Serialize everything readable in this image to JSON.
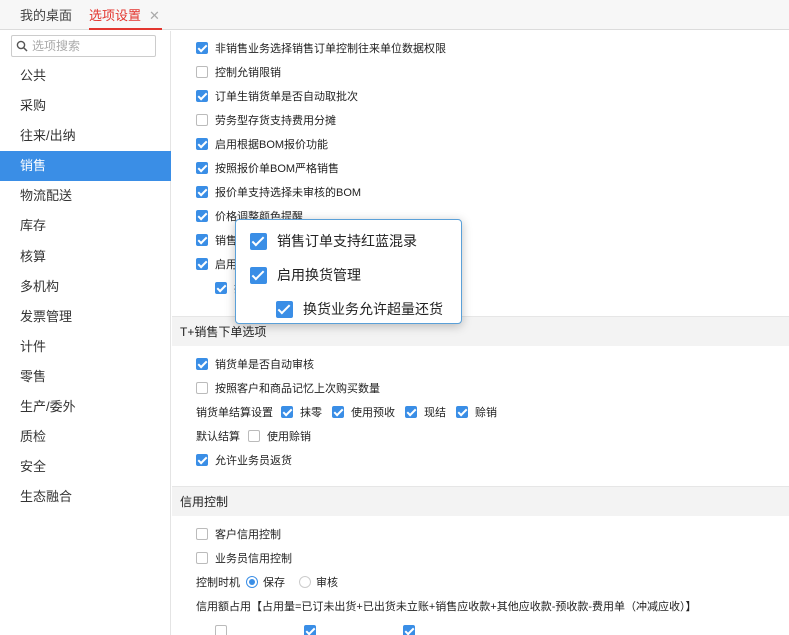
{
  "tabs": [
    {
      "label": "我的桌面"
    },
    {
      "label": "选项设置",
      "close": "✕"
    }
  ],
  "search": {
    "placeholder": "选项搜索"
  },
  "nav": [
    "公共",
    "采购",
    "往来/出纳",
    "销售",
    "物流配送",
    "库存",
    "核算",
    "多机构",
    "发票管理",
    "计件",
    "零售",
    "生产/委外",
    "质检",
    "安全",
    "生态融合"
  ],
  "nav_active": "销售",
  "options": [
    {
      "label": "非销售业务选择销售订单控制往来单位数据权限",
      "checked": true
    },
    {
      "label": "控制允销限销",
      "checked": false
    },
    {
      "label": "订单生销货单是否自动取批次",
      "checked": true
    },
    {
      "label": "劳务型存货支持费用分摊",
      "checked": false
    },
    {
      "label": "启用根据BOM报价功能",
      "checked": true
    },
    {
      "label": "按照报价单BOM严格销售",
      "checked": true
    },
    {
      "label": "报价单支持选择未审核的BOM",
      "checked": true
    },
    {
      "label": "价格调整颜色提醒",
      "checked": true
    },
    {
      "label": "销售",
      "checked": true
    },
    {
      "label": "启用",
      "checked": true
    },
    {
      "label": "换",
      "checked": true
    }
  ],
  "popup": [
    {
      "label": "销售订单支持红蓝混录"
    },
    {
      "label": "启用换货管理"
    },
    {
      "label": "换货业务允许超量还货"
    }
  ],
  "section_tplus": {
    "title": "T+销售下单选项"
  },
  "tplus": {
    "auto_audit": "销货单是否自动审核",
    "remember_qty": "按照客户和商品记忆上次购买数量",
    "settle_label": "销货单结算设置",
    "settle_opts": [
      "抹零",
      "使用预收",
      "现结",
      "赊销"
    ],
    "default_label": "默认结算",
    "use_credit": "使用赊销",
    "allow_return": "允许业务员返货"
  },
  "section_credit": {
    "title": "信用控制"
  },
  "credit": {
    "customer": "客户信用控制",
    "salesman": "业务员信用控制",
    "timing_label": "控制时机",
    "timing_opts": [
      "保存",
      "审核"
    ],
    "usage": "信用额占用【占用量=已订未出货+已出货未立账+销售应收款+其他应收款-预收款-费用单（冲减应收）】"
  },
  "colors": {
    "accent": "#3a8ee6",
    "tab_active": "#e3362f"
  }
}
